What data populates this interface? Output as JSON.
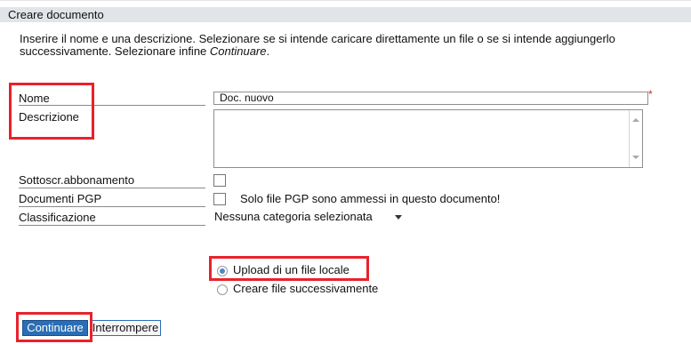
{
  "header": {
    "title": "Creare documento"
  },
  "intro": {
    "text_before": "Inserire il nome e una descrizione. Selezionare se si intende caricare direttamente un file o se si intende aggiungerlo successivamente. Selezionare infine ",
    "emphasis": "Continuare",
    "text_after": "."
  },
  "form": {
    "name_label": "Nome",
    "name_value": "Doc. nuovo",
    "required_mark": "*",
    "description_label": "Descrizione",
    "description_value": "",
    "subscription_label": "Sottoscr.abbonamento",
    "pgp_label": "Documenti PGP",
    "pgp_note": "Solo file PGP sono ammessi in questo documento!",
    "classification_label": "Classificazione",
    "classification_value": "Nessuna categoria selezionata"
  },
  "upload": {
    "option_local": "Upload di un file locale",
    "option_later": "Creare file successivamente",
    "selected": "local"
  },
  "buttons": {
    "continue": "Continuare",
    "cancel": "Interrompere"
  },
  "colors": {
    "header_bg": "#e1e4e9",
    "highlight_red": "#e8222c",
    "primary_button": "#2a6eb5",
    "radio_selected": "#4f86c6"
  },
  "icons": {
    "dropdown": "chevron-down-icon",
    "scroll_up": "scroll-up-arrow-icon",
    "scroll_down": "scroll-down-arrow-icon"
  }
}
